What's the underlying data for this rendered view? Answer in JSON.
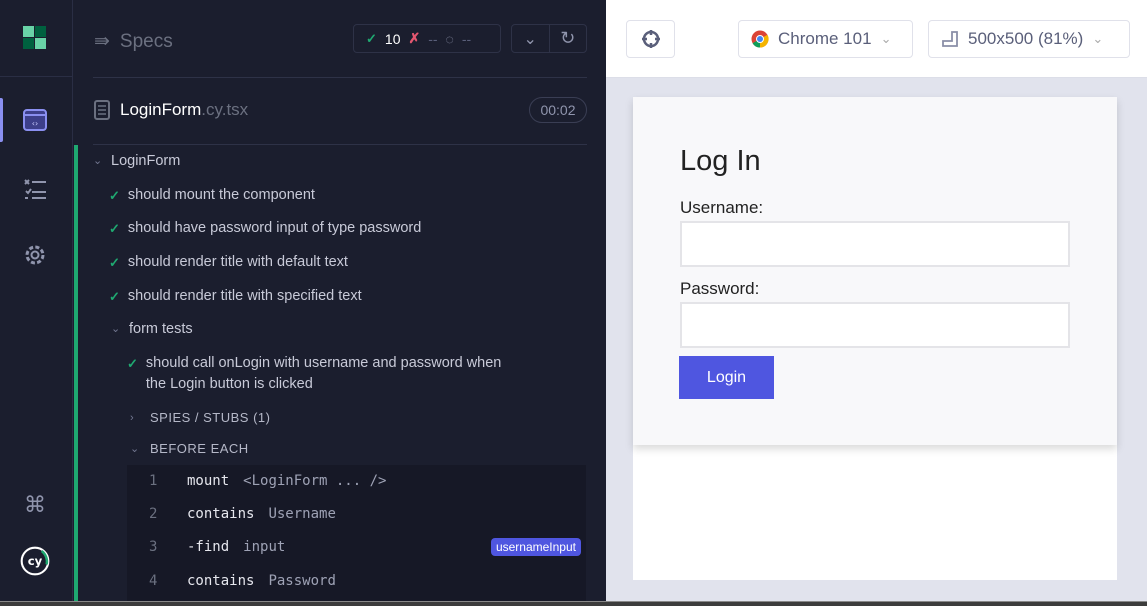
{
  "reporter": {
    "title": "Specs",
    "stats": {
      "passed": "10",
      "failed": "--",
      "pending": "--"
    },
    "file": {
      "name": "LoginForm",
      "ext": ".cy.tsx",
      "duration": "00:02"
    },
    "suite": "LoginForm",
    "tests": [
      "should mount the component",
      "should have password input of type password",
      "should render title with default text",
      "should render title with specified text"
    ],
    "nested_suite": "form tests",
    "nested_test": [
      "should call onLogin with username and password when",
      "the Login button is clicked"
    ],
    "spies_label": "SPIES / STUBS (1)",
    "before_each_label": "BEFORE EACH",
    "commands": [
      {
        "num": "1",
        "name": "mount",
        "arg": "<LoginForm ... />"
      },
      {
        "num": "2",
        "name": "contains",
        "arg": "Username"
      },
      {
        "num": "3",
        "name": "-find",
        "arg": "input",
        "alias": "usernameInput"
      },
      {
        "num": "4",
        "name": "contains",
        "arg": "Password"
      }
    ]
  },
  "toolbar": {
    "browser": "Chrome 101",
    "viewport": "500x500 (81%)"
  },
  "app": {
    "title": "Log In",
    "username_label": "Username:",
    "password_label": "Password:",
    "login_button": "Login"
  },
  "colors": {
    "pass": "#1fa971",
    "fail": "#e45770",
    "accent": "#4f56e0"
  }
}
